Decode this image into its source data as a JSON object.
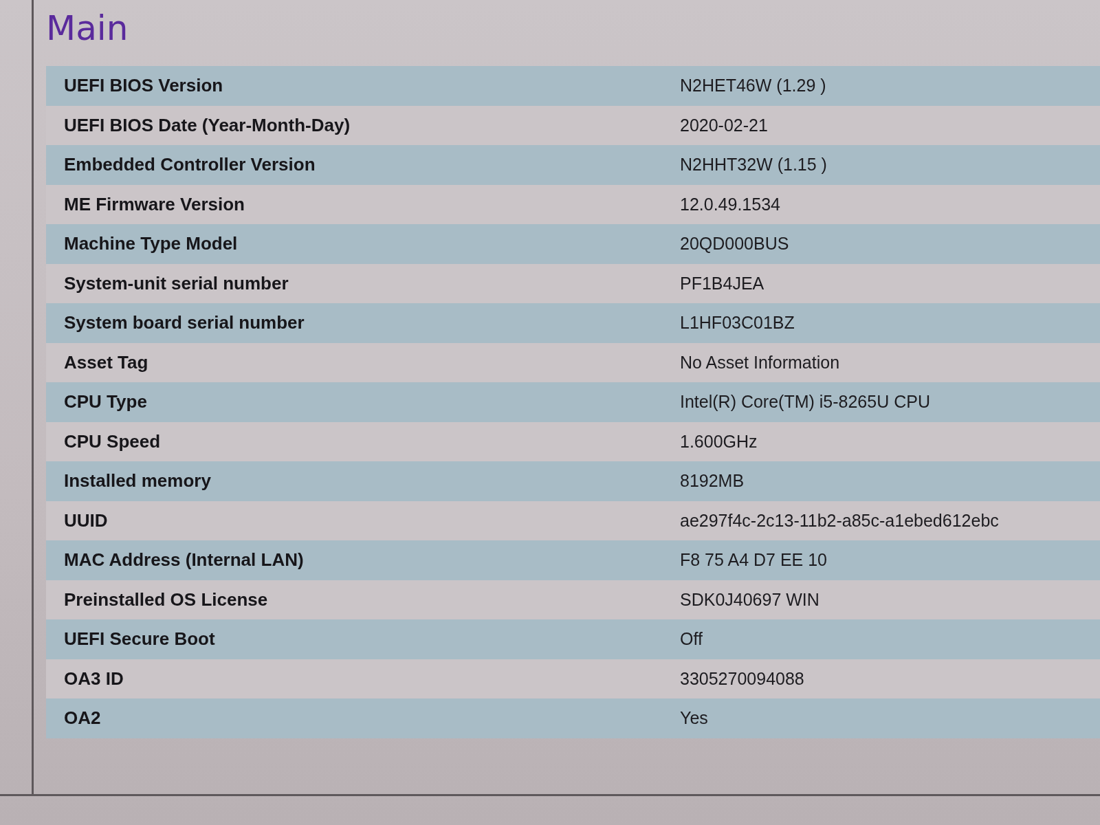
{
  "page": {
    "title": "Main"
  },
  "rows": [
    {
      "label": "UEFI BIOS Version",
      "value": "N2HET46W (1.29 )"
    },
    {
      "label": "UEFI BIOS Date (Year-Month-Day)",
      "value": "2020-02-21"
    },
    {
      "label": "Embedded Controller Version",
      "value": "N2HHT32W (1.15 )"
    },
    {
      "label": "ME Firmware Version",
      "value": "12.0.49.1534"
    },
    {
      "label": "Machine Type Model",
      "value": "20QD000BUS"
    },
    {
      "label": "System-unit serial number",
      "value": "PF1B4JEA"
    },
    {
      "label": "System board serial number",
      "value": "L1HF03C01BZ"
    },
    {
      "label": "Asset Tag",
      "value": "No Asset Information"
    },
    {
      "label": "CPU Type",
      "value": "Intel(R) Core(TM) i5-8265U CPU"
    },
    {
      "label": "CPU Speed",
      "value": "1.600GHz"
    },
    {
      "label": "Installed memory",
      "value": "8192MB"
    },
    {
      "label": "UUID",
      "value": "ae297f4c-2c13-11b2-a85c-a1ebed612ebc"
    },
    {
      "label": "MAC Address (Internal LAN)",
      "value": "F8 75 A4 D7 EE 10"
    },
    {
      "label": "Preinstalled OS License",
      "value": "SDK0J40697 WIN"
    },
    {
      "label": "UEFI Secure Boot",
      "value": "Off"
    },
    {
      "label": "OA3 ID",
      "value": "3305270094088"
    },
    {
      "label": "OA2",
      "value": "Yes"
    }
  ]
}
